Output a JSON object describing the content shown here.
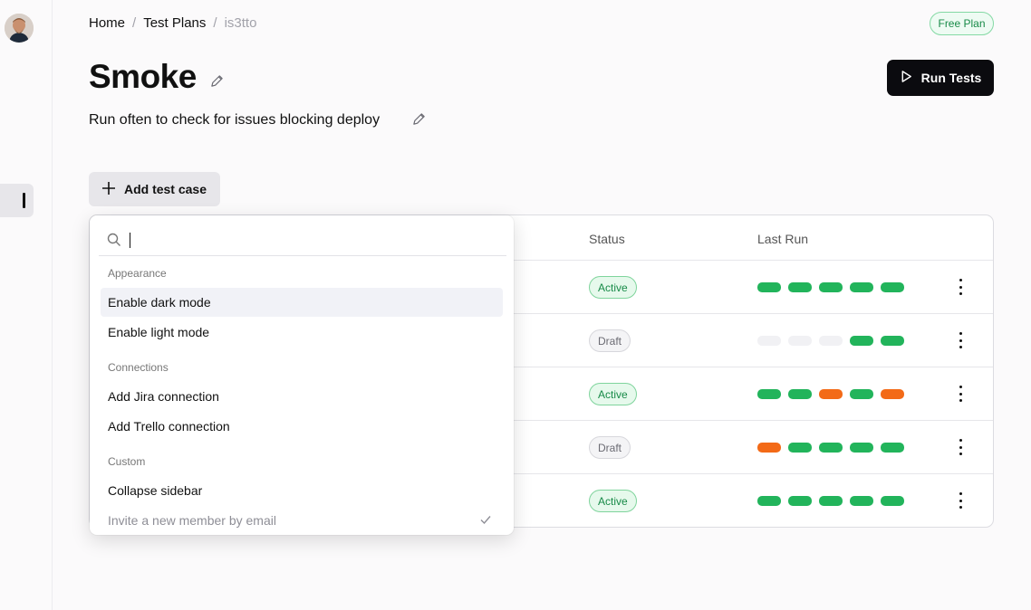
{
  "breadcrumb": {
    "home": "Home",
    "sep1": "/",
    "section": "Test Plans",
    "sep2": "/",
    "current": "is3tto"
  },
  "plan_badge": "Free Plan",
  "page": {
    "title": "Smoke",
    "subtitle": "Run often to check for issues blocking deploy"
  },
  "run_button": {
    "label": "Run Tests"
  },
  "add_button": {
    "label": "Add test case"
  },
  "table": {
    "headers": {
      "status": "Status",
      "last_run": "Last Run"
    },
    "rows": [
      {
        "status": "Active",
        "runs": [
          "pass",
          "pass",
          "pass",
          "pass",
          "pass"
        ]
      },
      {
        "status": "Draft",
        "runs": [
          "none",
          "none",
          "none",
          "pass",
          "pass"
        ]
      },
      {
        "status": "Active",
        "runs": [
          "pass",
          "pass",
          "fail",
          "pass",
          "fail"
        ]
      },
      {
        "status": "Draft",
        "runs": [
          "fail",
          "pass",
          "pass",
          "pass",
          "pass"
        ]
      },
      {
        "status": "Active",
        "runs": [
          "pass",
          "pass",
          "pass",
          "pass",
          "pass"
        ]
      }
    ]
  },
  "dropdown": {
    "search_value": "",
    "groups": {
      "appearance": "Appearance",
      "connections": "Connections",
      "custom": "Custom"
    },
    "items": {
      "dark_mode": "Enable dark mode",
      "light_mode": "Enable light mode",
      "jira": "Add Jira connection",
      "trello": "Add Trello connection",
      "collapse": "Collapse sidebar",
      "invite": "Invite a new member by email"
    }
  },
  "colors": {
    "pass": "#22b45b",
    "fail": "#f36a17",
    "none": "#f1f1f4",
    "accent_dark": "#0b0b0f"
  }
}
